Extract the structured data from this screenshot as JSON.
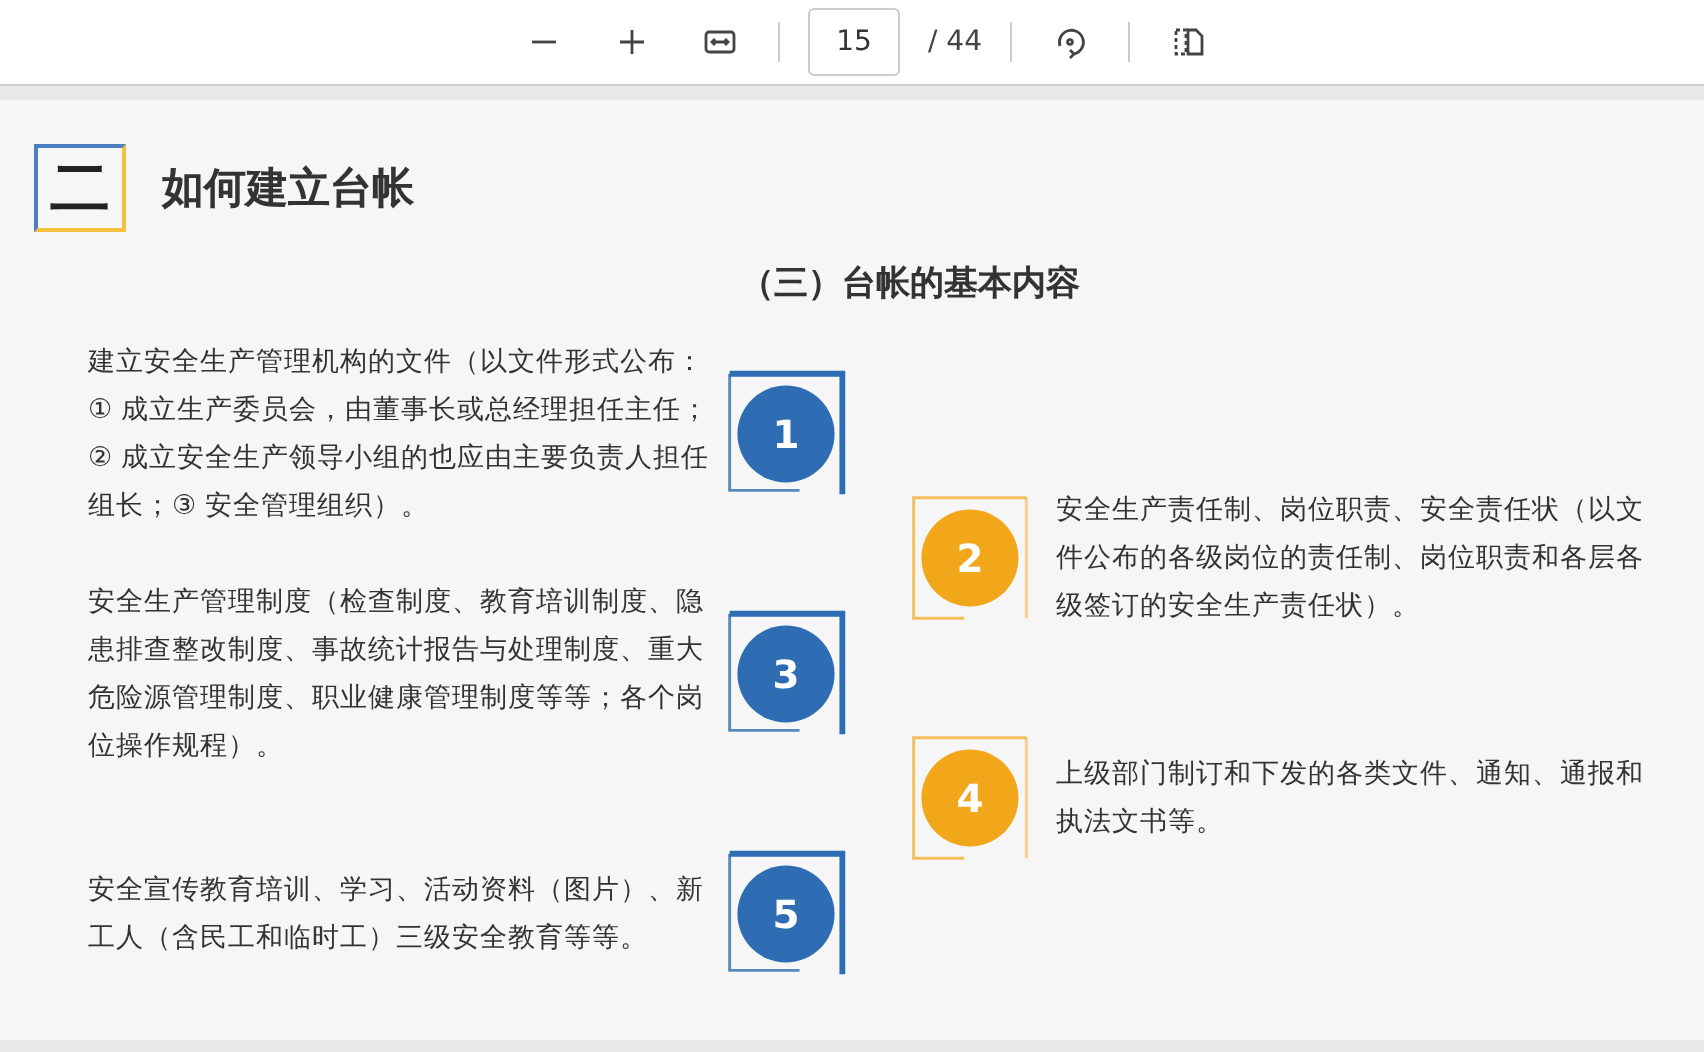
{
  "toolbar": {
    "page_number": "15",
    "page_total": "/ 44"
  },
  "section": {
    "number": "二",
    "title": "如何建立台帐"
  },
  "subtitle": "（三）台帐的基本内容",
  "items": [
    {
      "kind": "left",
      "number": "1",
      "color": "#2e6db4",
      "text": "建立安全生产管理机构的文件（以文件形式公布：① 成立生产委员会，由董事长或总经理担任主任；② 成立安全生产领导小组的也应由主要负责人担任组长；③ 安全管理组织）。"
    },
    {
      "kind": "right",
      "number": "2",
      "color": "#f2a71b",
      "text": "安全生产责任制、岗位职责、安全责任状（以文件公布的各级岗位的责任制、岗位职责和各层各级签订的安全生产责任状）。"
    },
    {
      "kind": "left",
      "number": "3",
      "color": "#2e6db4",
      "text": "安全生产管理制度（检查制度、教育培训制度、隐患排查整改制度、事故统计报告与处理制度、重大危险源管理制度、职业健康管理制度等等；各个岗位操作规程）。"
    },
    {
      "kind": "right",
      "number": "4",
      "color": "#f2a71b",
      "text": "上级部门制订和下发的各类文件、通知、通报和执法文书等。"
    },
    {
      "kind": "left",
      "number": "5",
      "color": "#2e6db4",
      "text": "安全宣传教育培训、学习、活动资料（图片）、新工人（含民工和临时工）三级安全教育等等。"
    }
  ]
}
